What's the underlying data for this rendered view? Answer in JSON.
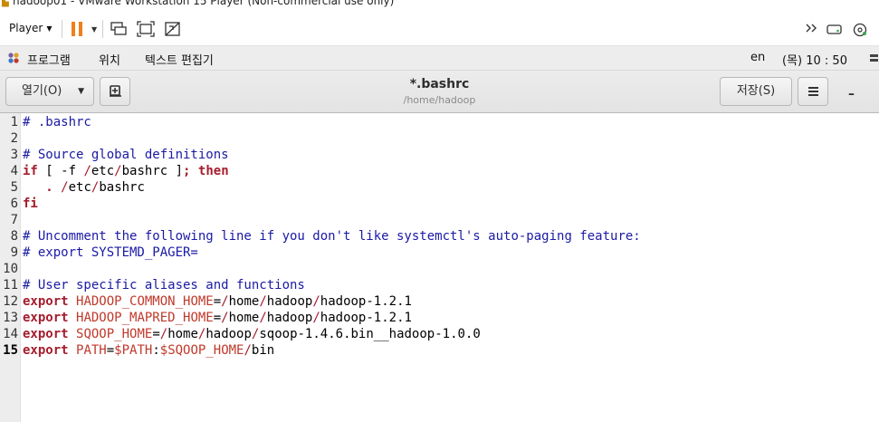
{
  "vmware": {
    "window_title": "hadoop01 - VMware Workstation 15 Player (Non-commercial use only)",
    "player_menu": "Player",
    "accent_pause": "#f07f1a"
  },
  "gnome": {
    "apps_menu": "프로그램",
    "places_menu": "위치",
    "active_app": "텍스트 편집기",
    "keyboard": "en",
    "clock": "(목) 10 : 50"
  },
  "gedit": {
    "open_label": "열기(O)",
    "save_label": "저장(S)",
    "doc_title": "*.bashrc",
    "doc_path": "/home/hadoop"
  },
  "editor": {
    "current_line": 15,
    "lines": [
      {
        "n": "1",
        "tokens": [
          [
            "c",
            "# .bashrc"
          ]
        ]
      },
      {
        "n": "2",
        "tokens": []
      },
      {
        "n": "3",
        "tokens": [
          [
            "c",
            "# Source global definitions"
          ]
        ]
      },
      {
        "n": "4",
        "tokens": [
          [
            "k",
            "if"
          ],
          [
            "p",
            " [ -f "
          ],
          [
            "s",
            "/"
          ],
          [
            "p",
            "etc"
          ],
          [
            "s",
            "/"
          ],
          [
            "p",
            "bashrc ]"
          ],
          [
            "k",
            "; then"
          ]
        ]
      },
      {
        "n": "5",
        "tokens": [
          [
            "p",
            "   "
          ],
          [
            "k",
            "."
          ],
          [
            "p",
            " "
          ],
          [
            "s",
            "/"
          ],
          [
            "p",
            "etc"
          ],
          [
            "s",
            "/"
          ],
          [
            "p",
            "bashrc"
          ]
        ]
      },
      {
        "n": "6",
        "tokens": [
          [
            "k",
            "fi"
          ]
        ]
      },
      {
        "n": "7",
        "tokens": []
      },
      {
        "n": "8",
        "tokens": [
          [
            "c",
            "# Uncomment the following line if you don't like systemctl's auto-paging feature:"
          ]
        ]
      },
      {
        "n": "9",
        "tokens": [
          [
            "c",
            "# export SYSTEMD_PAGER="
          ]
        ]
      },
      {
        "n": "10",
        "tokens": []
      },
      {
        "n": "11",
        "tokens": [
          [
            "c",
            "# User specific aliases and functions"
          ]
        ]
      },
      {
        "n": "12",
        "tokens": [
          [
            "k",
            "export"
          ],
          [
            "p",
            " "
          ],
          [
            "v",
            "HADOOP_COMMON_HOME"
          ],
          [
            "p",
            "="
          ],
          [
            "s",
            "/"
          ],
          [
            "p",
            "home"
          ],
          [
            "s",
            "/"
          ],
          [
            "p",
            "hadoop"
          ],
          [
            "s",
            "/"
          ],
          [
            "p",
            "hadoop-1.2.1"
          ]
        ]
      },
      {
        "n": "13",
        "tokens": [
          [
            "k",
            "export"
          ],
          [
            "p",
            " "
          ],
          [
            "v",
            "HADOOP_MAPRED_HOME"
          ],
          [
            "p",
            "="
          ],
          [
            "s",
            "/"
          ],
          [
            "p",
            "home"
          ],
          [
            "s",
            "/"
          ],
          [
            "p",
            "hadoop"
          ],
          [
            "s",
            "/"
          ],
          [
            "p",
            "hadoop-1.2.1"
          ]
        ]
      },
      {
        "n": "14",
        "tokens": [
          [
            "k",
            "export"
          ],
          [
            "p",
            " "
          ],
          [
            "v",
            "SQOOP_HOME"
          ],
          [
            "p",
            "="
          ],
          [
            "s",
            "/"
          ],
          [
            "p",
            "home"
          ],
          [
            "s",
            "/"
          ],
          [
            "p",
            "hadoop"
          ],
          [
            "s",
            "/"
          ],
          [
            "p",
            "sqoop-1.4.6.bin__hadoop-1.0.0"
          ]
        ]
      },
      {
        "n": "15",
        "tokens": [
          [
            "k",
            "export"
          ],
          [
            "p",
            " "
          ],
          [
            "v",
            "PATH"
          ],
          [
            "p",
            "="
          ],
          [
            "v",
            "$PATH"
          ],
          [
            "p",
            ":"
          ],
          [
            "v",
            "$SQOOP_HOME"
          ],
          [
            "s",
            "/"
          ],
          [
            "p",
            "bin"
          ]
        ]
      }
    ]
  }
}
